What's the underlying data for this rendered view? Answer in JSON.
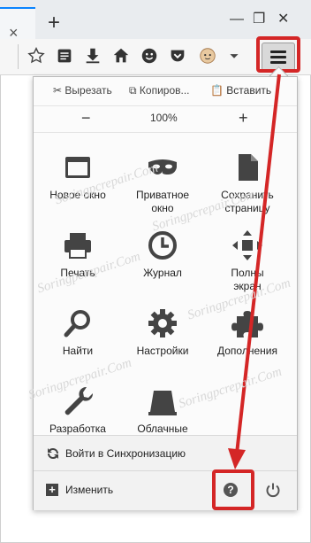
{
  "toolbar": {
    "menu_icon": "hamburger-menu-icon",
    "icons": [
      "star-icon",
      "reading-list-icon",
      "download-icon",
      "home-icon",
      "hello-icon",
      "pocket-icon",
      "avatar-icon",
      "dropdown-icon"
    ]
  },
  "tabstrip": {
    "close_glyph": "×",
    "new_tab_glyph": "+",
    "window_controls": [
      "—",
      "❐",
      "✕"
    ]
  },
  "menu": {
    "edit": {
      "cut": "Вырезать",
      "copy": "Копиров...",
      "paste": "Вставить"
    },
    "zoom": {
      "minus": "−",
      "value": "100%",
      "plus": "+"
    },
    "items": [
      {
        "label": "Новое окно",
        "icon": "new-window-icon"
      },
      {
        "label": "Приватное\nокно",
        "icon": "private-mask-icon"
      },
      {
        "label": "Сохранить\nстраницу",
        "icon": "save-page-icon"
      },
      {
        "label": "Печать",
        "icon": "print-icon"
      },
      {
        "label": "Журнал",
        "icon": "history-clock-icon"
      },
      {
        "label": "Полны\nэкран",
        "icon": "fullscreen-icon"
      },
      {
        "label": "Найти",
        "icon": "find-magnifier-icon"
      },
      {
        "label": "Настройки",
        "icon": "settings-gear-icon"
      },
      {
        "label": "Дополнения",
        "icon": "addons-puzzle-icon"
      },
      {
        "label": "Разработка",
        "icon": "developer-wrench-icon"
      },
      {
        "label": "Облачные\nвкладки",
        "icon": "cloud-tabs-icon"
      }
    ],
    "sync_label": "Войти в Синхронизацию",
    "customize_label": "Изменить"
  },
  "watermark": "Soringpcrepair.Com",
  "colors": {
    "highlight": "#d42626",
    "accent": "#0a84ff"
  }
}
